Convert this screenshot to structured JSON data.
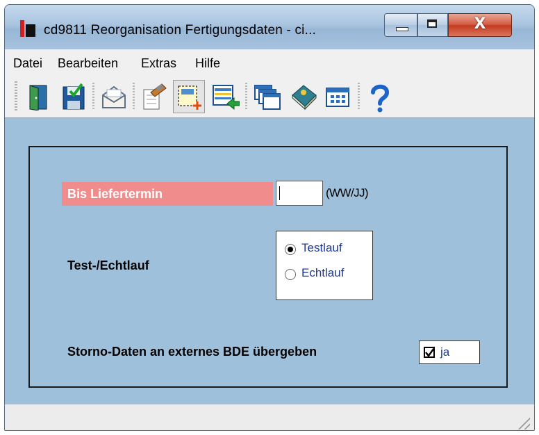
{
  "window": {
    "title": "cd9811 Reorganisation Fertigungsdaten - ci...",
    "close_glyph": "X"
  },
  "menu": {
    "items": [
      "Datei",
      "Bearbeiten",
      "Extras",
      "Hilfe"
    ]
  },
  "toolbar": {
    "buttons": [
      {
        "icon": "exit-door-icon",
        "active": false
      },
      {
        "icon": "save-icon",
        "active": false
      },
      {
        "icon": "mail-icon",
        "active": false
      },
      {
        "icon": "edit-document-icon",
        "active": false
      },
      {
        "icon": "new-selection-icon",
        "active": true
      },
      {
        "icon": "list-transfer-icon",
        "active": false
      },
      {
        "icon": "windows-stack-icon",
        "active": false
      },
      {
        "icon": "book-icon",
        "active": false
      },
      {
        "icon": "calendar-grid-icon",
        "active": false
      },
      {
        "icon": "help-icon",
        "active": false
      }
    ]
  },
  "form": {
    "delivery_date_label": "Bis Liefertermin",
    "delivery_date_value": "",
    "delivery_date_hint": "(WW/JJ)",
    "run_mode_label": "Test-/Echtlauf",
    "run_mode_options": [
      "Testlauf",
      "Echtlauf"
    ],
    "run_mode_selected": "Testlauf",
    "storno_label": "Storno-Daten an externes BDE übergeben",
    "storno_checkbox_label": "ja",
    "storno_checked": true
  },
  "colors": {
    "client_bg": "#9fc0da",
    "required_label_bg": "#f08c8c",
    "option_text": "#1b3a9a"
  }
}
